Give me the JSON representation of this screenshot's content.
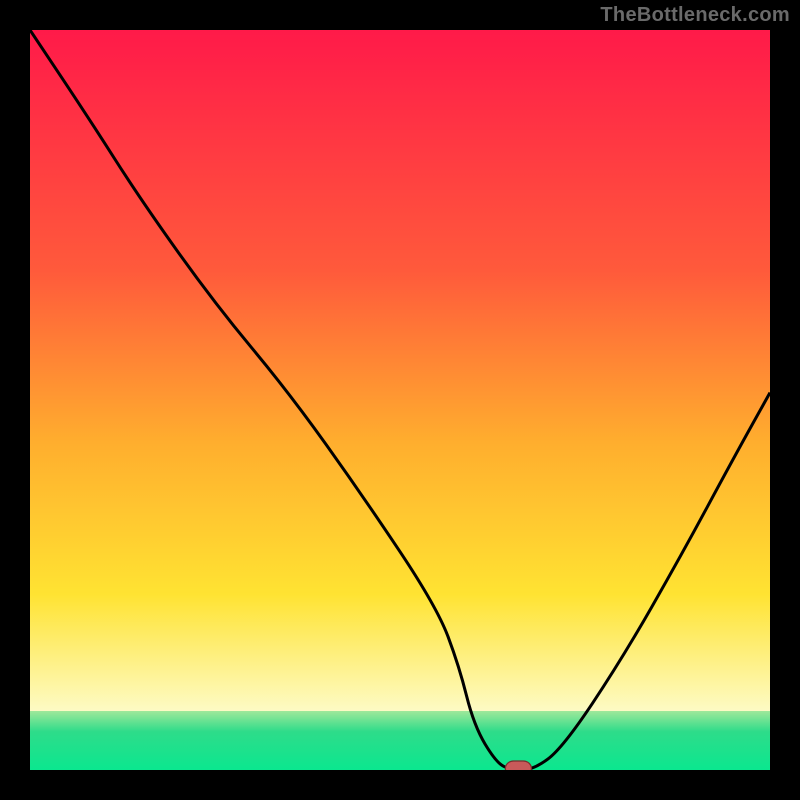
{
  "watermark": "TheBottleneck.com",
  "colors": {
    "top": "#ff1a49",
    "mid1": "#ff5a3b",
    "mid2": "#ffae2e",
    "mid3": "#ffe332",
    "low": "#fdfccd",
    "gtop": "#9fe89a",
    "gmid": "#2edc8a",
    "gbot": "#0be78f",
    "marker": "#c95a5a",
    "marker_stroke": "#7a2d2d"
  },
  "chart_data": {
    "type": "line",
    "title": "",
    "xlabel": "",
    "ylabel": "",
    "xlim": [
      0,
      100
    ],
    "ylim": [
      0,
      100
    ],
    "series": [
      {
        "name": "bottleneck-curve",
        "x": [
          0,
          8,
          15,
          25,
          35,
          45,
          55,
          58,
          60,
          63,
          65,
          68,
          72,
          80,
          88,
          95,
          100
        ],
        "y": [
          100,
          88,
          77,
          63,
          51,
          37,
          22,
          14,
          6,
          1,
          0,
          0,
          3,
          15,
          29,
          42,
          51
        ]
      }
    ],
    "annotations": [
      {
        "name": "optimum-marker",
        "x": 66,
        "y": 0
      }
    ]
  }
}
